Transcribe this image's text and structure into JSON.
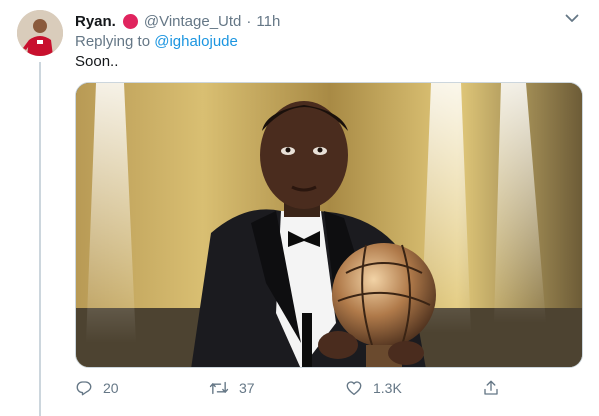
{
  "tweet": {
    "display_name": "Ryan.",
    "handle": "@Vintage_Utd",
    "separator": "·",
    "time": "11h",
    "replying_prefix": "Replying to",
    "replying_to": "@ighalojude",
    "text": "Soon..",
    "badge_color": "#e0245e"
  },
  "actions": {
    "reply_count": "20",
    "retweet_count": "37",
    "like_count": "1.3K"
  },
  "icons": {
    "caret": "chevron-down-icon",
    "reply": "reply-icon",
    "retweet": "retweet-icon",
    "like": "heart-icon",
    "share": "share-icon"
  },
  "colors": {
    "primary_text": "#14171a",
    "secondary_text": "#657786",
    "link": "#1b95e0",
    "border": "#ccd6dd"
  }
}
